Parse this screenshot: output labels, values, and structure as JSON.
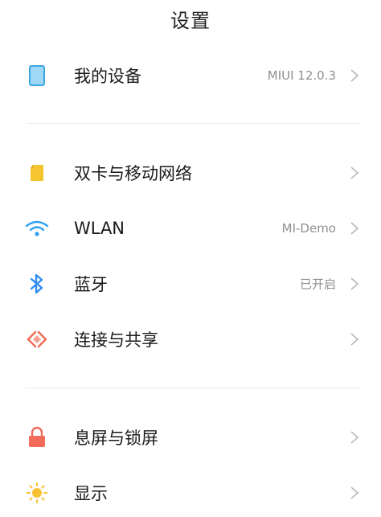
{
  "header": {
    "title": "设置"
  },
  "sections": [
    {
      "items": [
        {
          "label": "我的设备",
          "value": "MIUI 12.0.3",
          "icon": "phone-icon",
          "color": "#4aaee6"
        }
      ]
    },
    {
      "items": [
        {
          "label": "双卡与移动网络",
          "value": "",
          "icon": "sim-card-icon",
          "color": "#f5c530"
        },
        {
          "label": "WLAN",
          "value": "MI-Demo",
          "icon": "wifi-icon",
          "color": "#2f9ff0"
        },
        {
          "label": "蓝牙",
          "value": "已开启",
          "icon": "bluetooth-icon",
          "color": "#2f8df0"
        },
        {
          "label": "连接与共享",
          "value": "",
          "icon": "share-connection-icon",
          "color": "#f0705a"
        }
      ]
    },
    {
      "items": [
        {
          "label": "息屏与锁屏",
          "value": "",
          "icon": "lock-icon",
          "color": "#f36b5b"
        },
        {
          "label": "显示",
          "value": "",
          "icon": "sun-icon",
          "color": "#f7c133"
        }
      ]
    }
  ]
}
